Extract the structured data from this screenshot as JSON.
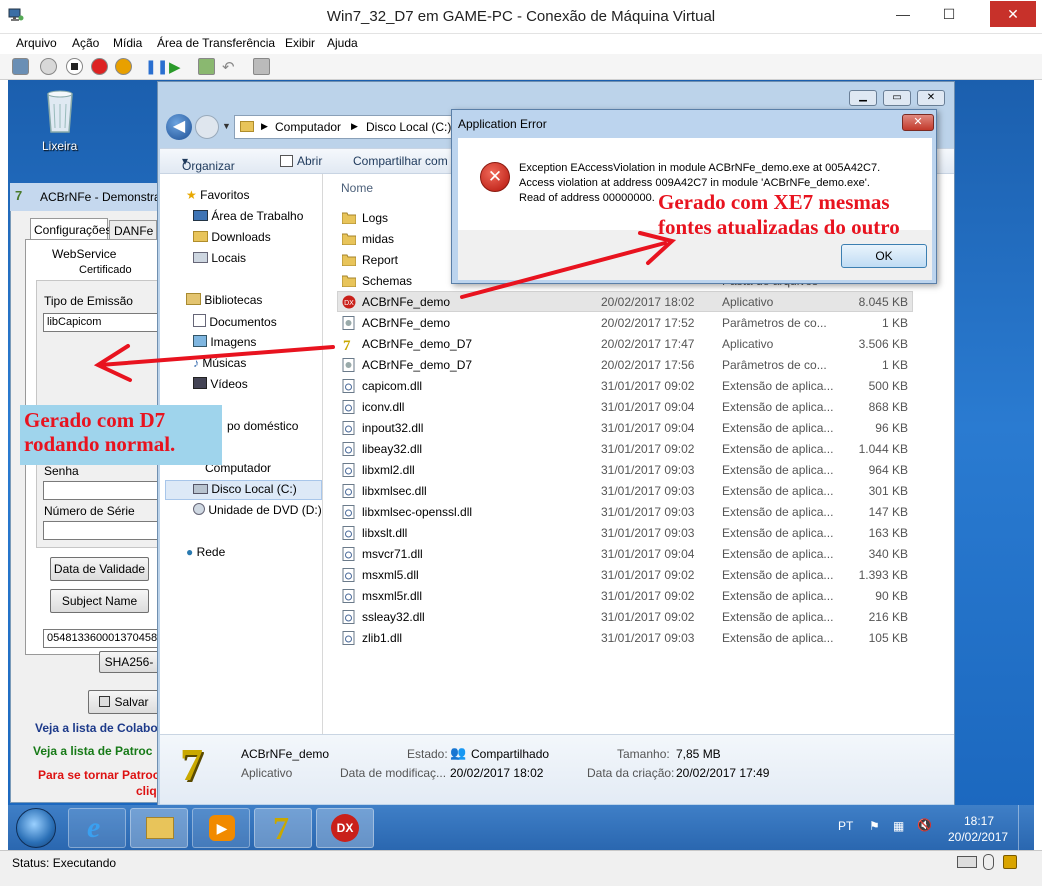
{
  "host": {
    "title": "Win7_32_D7 em GAME-PC - Conexão de Máquina Virtual",
    "menu": [
      "Arquivo",
      "Ação",
      "Mídia",
      "Área de Transferência",
      "Exibir",
      "Ajuda"
    ],
    "status": "Status: Executando"
  },
  "desktop": {
    "recycle_bin_label": "Lixeira"
  },
  "acbr": {
    "title": "ACBrNFe - Demonstra",
    "tabs": [
      "Configurações",
      "DANFe"
    ],
    "subtabs": [
      "WebService",
      "Certificado"
    ],
    "tipo_emissao_label": "Tipo de Emissão",
    "tipo_emissao_value": "libCapicom",
    "senha_label": "Senha",
    "numero_serie_label": "Número de Série",
    "data_validade_button": "Data de Validade",
    "subject_name_button": "Subject Name",
    "serial_value": "054813360001370458",
    "sha_button": "SHA256-",
    "salvar_button": "Salvar",
    "link1": "Veja a lista de Colabo",
    "link2": "Veja a lista de Patroc",
    "link3a": "Para se tornar Patroc",
    "link3b": "cliq"
  },
  "explorer": {
    "breadcrumb": [
      "Computador",
      "Disco Local (C:)"
    ],
    "toolbar": [
      "Organizar",
      "Abrir",
      "Compartilhar com"
    ],
    "nav": {
      "favoritos": "Favoritos",
      "area_trabalho": "Área de Trabalho",
      "downloads": "Downloads",
      "locais": "Locais",
      "bibliotecas": "Bibliotecas",
      "documentos": "Documentos",
      "imagens": "Imagens",
      "musicas": "Músicas",
      "videos": "Vídeos",
      "grupo": "po doméstico",
      "computador": "Computador",
      "disco_local": "Disco Local (C:)",
      "dvd": "Unidade de DVD (D:)",
      "rede": "Rede"
    },
    "column_name": "Nome",
    "files": [
      {
        "name": "Logs",
        "date": "",
        "type": "",
        "size": "",
        "icon": "folder"
      },
      {
        "name": "midas",
        "date": "",
        "type": "",
        "size": "",
        "icon": "folder"
      },
      {
        "name": "Report",
        "date": "",
        "type": "",
        "size": "",
        "icon": "folder"
      },
      {
        "name": "Schemas",
        "date": "",
        "type": "Pasta de arquivos",
        "size": "",
        "icon": "folder"
      },
      {
        "name": "ACBrNFe_demo",
        "date": "20/02/2017 18:02",
        "type": "Aplicativo",
        "size": "8.045 KB",
        "icon": "dx"
      },
      {
        "name": "ACBrNFe_demo",
        "date": "20/02/2017 17:52",
        "type": "Parâmetros de co...",
        "size": "1 KB",
        "icon": "cfg"
      },
      {
        "name": "ACBrNFe_demo_D7",
        "date": "20/02/2017 17:47",
        "type": "Aplicativo",
        "size": "3.506 KB",
        "icon": "d7"
      },
      {
        "name": "ACBrNFe_demo_D7",
        "date": "20/02/2017 17:56",
        "type": "Parâmetros de co...",
        "size": "1 KB",
        "icon": "cfg"
      },
      {
        "name": "capicom.dll",
        "date": "31/01/2017 09:02",
        "type": "Extensão de aplica...",
        "size": "500 KB",
        "icon": "dll"
      },
      {
        "name": "iconv.dll",
        "date": "31/01/2017 09:04",
        "type": "Extensão de aplica...",
        "size": "868 KB",
        "icon": "dll"
      },
      {
        "name": "inpout32.dll",
        "date": "31/01/2017 09:04",
        "type": "Extensão de aplica...",
        "size": "96 KB",
        "icon": "dll"
      },
      {
        "name": "libeay32.dll",
        "date": "31/01/2017 09:02",
        "type": "Extensão de aplica...",
        "size": "1.044 KB",
        "icon": "dll"
      },
      {
        "name": "libxml2.dll",
        "date": "31/01/2017 09:03",
        "type": "Extensão de aplica...",
        "size": "964 KB",
        "icon": "dll"
      },
      {
        "name": "libxmlsec.dll",
        "date": "31/01/2017 09:03",
        "type": "Extensão de aplica...",
        "size": "301 KB",
        "icon": "dll"
      },
      {
        "name": "libxmlsec-openssl.dll",
        "date": "31/01/2017 09:03",
        "type": "Extensão de aplica...",
        "size": "147 KB",
        "icon": "dll"
      },
      {
        "name": "libxslt.dll",
        "date": "31/01/2017 09:03",
        "type": "Extensão de aplica...",
        "size": "163 KB",
        "icon": "dll"
      },
      {
        "name": "msvcr71.dll",
        "date": "31/01/2017 09:04",
        "type": "Extensão de aplica...",
        "size": "340 KB",
        "icon": "dll"
      },
      {
        "name": "msxml5.dll",
        "date": "31/01/2017 09:02",
        "type": "Extensão de aplica...",
        "size": "1.393 KB",
        "icon": "dll"
      },
      {
        "name": "msxml5r.dll",
        "date": "31/01/2017 09:02",
        "type": "Extensão de aplica...",
        "size": "90 KB",
        "icon": "dll"
      },
      {
        "name": "ssleay32.dll",
        "date": "31/01/2017 09:02",
        "type": "Extensão de aplica...",
        "size": "216 KB",
        "icon": "dll"
      },
      {
        "name": "zlib1.dll",
        "date": "31/01/2017 09:03",
        "type": "Extensão de aplica...",
        "size": "105 KB",
        "icon": "dll"
      }
    ],
    "details": {
      "name": "ACBrNFe_demo",
      "kind": "Aplicativo",
      "estado_label": "Estado:",
      "estado_value": "Compartilhado",
      "modificacao_label": "Data de modificaç...",
      "modificacao_value": "20/02/2017 18:02",
      "tamanho_label": "Tamanho:",
      "tamanho_value": "7,85 MB",
      "criacao_label": "Data da criação:",
      "criacao_value": "20/02/2017 17:49"
    }
  },
  "dialog": {
    "title": "Application Error",
    "line1": "Exception EAccessViolation in module ACBrNFe_demo.exe at 005A42C7.",
    "line2": "Access violation at address 009A42C7 in module 'ACBrNFe_demo.exe'.",
    "line3": "Read of address 00000000.",
    "ok": "OK"
  },
  "annotations": {
    "xe7_line1": "Gerado com XE7 mesmas",
    "xe7_line2": "fontes atualizadas do outro",
    "d7_line1": "Gerado com D7",
    "d7_line2": "rodando normal."
  },
  "taskbar": {
    "lang": "PT",
    "time": "18:17",
    "date": "20/02/2017"
  },
  "colors": {
    "annotation_red": "#e8131f",
    "desktop_blue": "#1f6dc0",
    "selection": "#e5e5e5"
  }
}
